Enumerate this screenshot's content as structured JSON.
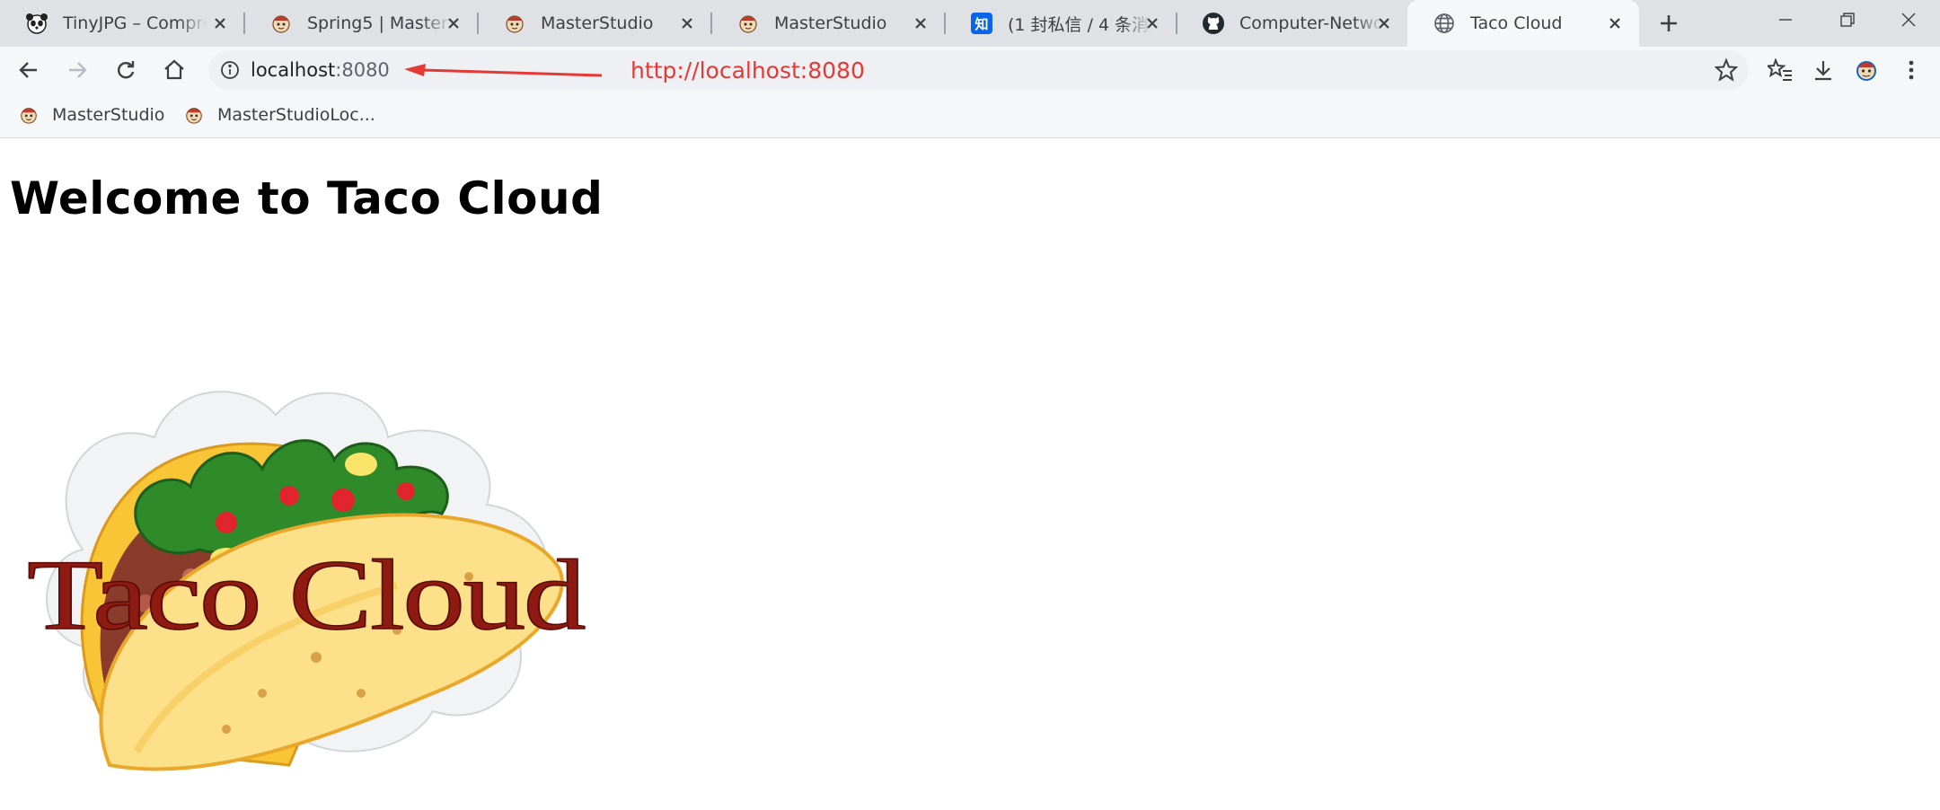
{
  "browser": {
    "tabs": [
      {
        "title": "TinyJPG – Compress",
        "icon": "panda-icon"
      },
      {
        "title": "Spring5 | MasterStudio",
        "icon": "masterstudio-icon"
      },
      {
        "title": "MasterStudio",
        "icon": "masterstudio-icon"
      },
      {
        "title": "MasterStudio",
        "icon": "masterstudio-icon"
      },
      {
        "title": "(1 封私信 / 4 条消息",
        "icon": "zhihu-icon"
      },
      {
        "title": "Computer-Networ",
        "icon": "github-icon"
      },
      {
        "title": "Taco Cloud",
        "icon": "globe-icon",
        "active": true
      }
    ],
    "address": {
      "host": "localhost",
      "port": ":8080"
    },
    "annotation": "http://localhost:8080",
    "bookmarks": [
      {
        "label": "MasterStudio",
        "icon": "masterstudio-icon"
      },
      {
        "label": "MasterStudioLoc...",
        "icon": "masterstudio-icon"
      }
    ],
    "colors": {
      "tabstrip": "#dfe1e5",
      "toolbar": "#f6f7f9",
      "annotation": "#e53935"
    }
  },
  "page": {
    "heading": "Welcome to Taco Cloud",
    "logo_text": "Taco Cloud"
  }
}
